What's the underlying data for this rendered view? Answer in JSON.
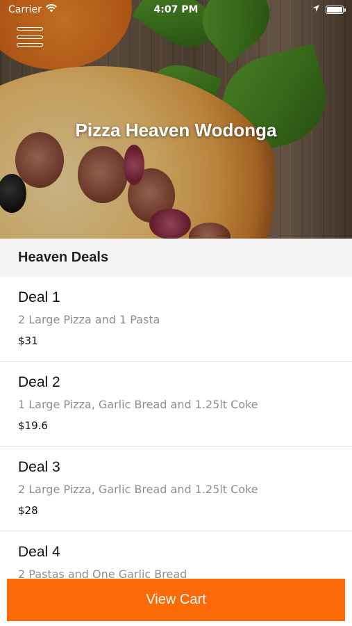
{
  "status_bar": {
    "carrier": "Carrier",
    "time": "4:07 PM"
  },
  "header": {
    "title": "Pizza Heaven Wodonga"
  },
  "section": {
    "title": "Heaven Deals"
  },
  "deals": [
    {
      "name": "Deal 1",
      "description": "2 Large Pizza and 1 Pasta",
      "price": "$31"
    },
    {
      "name": "Deal 2",
      "description": "1 Large Pizza, Garlic Bread and 1.25lt Coke",
      "price": "$19.6"
    },
    {
      "name": "Deal 3",
      "description": "2 Large Pizza, Garlic Bread and 1.25lt Coke",
      "price": "$28"
    },
    {
      "name": "Deal 4",
      "description": "2 Pastas and One Garlic Bread",
      "price": ""
    }
  ],
  "footer": {
    "view_cart_label": "View Cart"
  },
  "colors": {
    "accent": "#fc6a08",
    "section_bg": "#f4f4f4"
  }
}
